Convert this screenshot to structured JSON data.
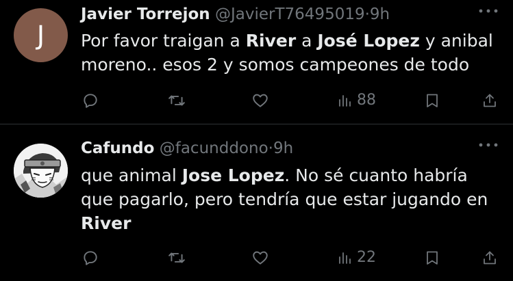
{
  "theme": {
    "background": "#000000",
    "text_primary": "#e7e9ea",
    "text_secondary": "#71767b",
    "divider": "#2f3336",
    "avatar_bg": "#825a4a"
  },
  "tweets": [
    {
      "avatar_letter": "J",
      "author_name": "Javier Torrejon",
      "author_handle": "@JavierT76495019",
      "separator": "·",
      "time": "9h",
      "text_segments": [
        {
          "text": "Por favor traigan a ",
          "bold": false
        },
        {
          "text": "River",
          "bold": true
        },
        {
          "text": " a ",
          "bold": false
        },
        {
          "text": "José Lopez",
          "bold": true
        },
        {
          "text": " y anibal moreno.. esos 2 y somos campeones de todo",
          "bold": false
        }
      ],
      "views_count": "88",
      "icons": [
        "reply-icon",
        "retweet-icon",
        "like-icon",
        "views-icon",
        "bookmark-icon",
        "share-icon",
        "more-icon"
      ]
    },
    {
      "avatar_letter": "",
      "author_name": "Cafundo",
      "author_handle": "@facunddono",
      "separator": "·",
      "time": "9h",
      "text_segments": [
        {
          "text": "que animal ",
          "bold": false
        },
        {
          "text": "Jose Lopez",
          "bold": true
        },
        {
          "text": ". No sé cuanto habría que pagarlo, pero tendría que estar jugando en ",
          "bold": false
        },
        {
          "text": "River",
          "bold": true
        }
      ],
      "views_count": "22",
      "icons": [
        "reply-icon",
        "retweet-icon",
        "like-icon",
        "views-icon",
        "bookmark-icon",
        "share-icon",
        "more-icon"
      ]
    }
  ]
}
